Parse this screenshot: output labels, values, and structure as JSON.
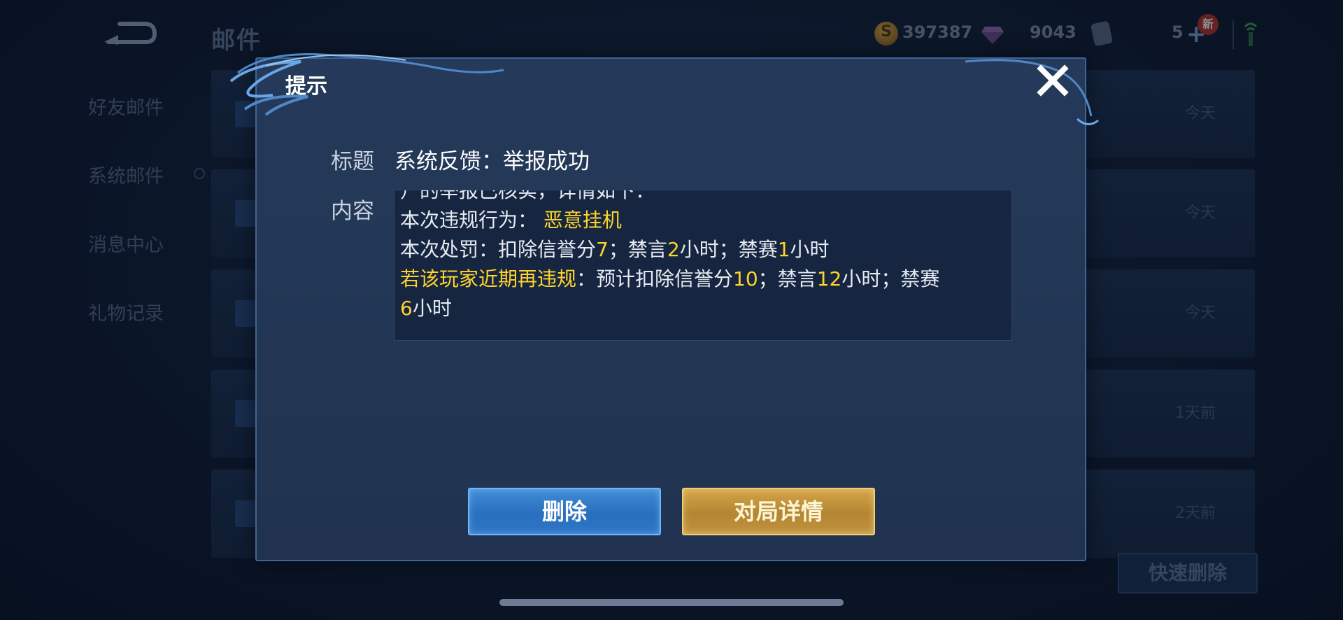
{
  "header": {
    "title": "邮件",
    "coins": "397387",
    "gems": "9043",
    "tickets": "5",
    "new_badge": "新"
  },
  "sidebar": {
    "items": [
      {
        "label": "好友邮件"
      },
      {
        "label": "系统邮件"
      },
      {
        "label": "消息中心"
      },
      {
        "label": "礼物记录"
      }
    ]
  },
  "mail_list": {
    "times": [
      "今天",
      "今天",
      "今天",
      "1天前",
      "2天前"
    ],
    "quick_delete_label": "快速删除"
  },
  "dialog": {
    "title": "提示",
    "subject_label": "标题",
    "subject": "系统反馈：举报成功",
    "content_label": "内容",
    "content": {
      "line0": "）的举报已核实，详情如下：",
      "violation_prefix": "本次违规行为：",
      "violation": "恶意挂机",
      "penalty_prefix": "本次处罚：扣除信誉分",
      "penalty_credit": "7",
      "penalty_mute_prefix": "；禁言",
      "penalty_mute": "2",
      "penalty_ban_prefix": "小时；禁赛",
      "penalty_ban": "1",
      "penalty_suffix": "小时",
      "repeat_prefix": "若该玩家近期再违规",
      "repeat_mid": "：预计扣除信誉分",
      "repeat_credit": "10",
      "repeat_mute_prefix": "；禁言",
      "repeat_mute": "12",
      "repeat_ban_prefix": "小时；禁赛",
      "repeat_ban": "6",
      "repeat_suffix": "小时"
    },
    "delete_label": "删除",
    "detail_label": "对局详情"
  },
  "colors": {
    "highlight": "#ffd42a",
    "delete_button": "#2a6fbe",
    "detail_button": "#b48632"
  }
}
